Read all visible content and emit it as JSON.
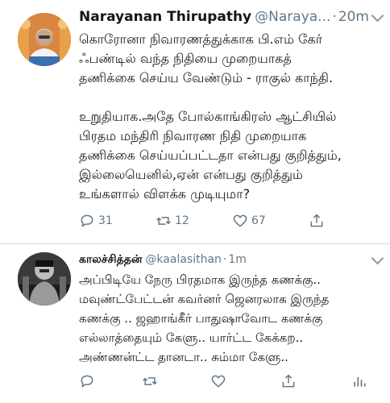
{
  "tweet1": {
    "name": "Narayanan Thirupathy",
    "handle": "@Naraya...",
    "separator": "·",
    "time": "20m",
    "text": "கொரோனா நிவாரணத்துக்காக பி.எம் கேர்\nஃபண்டில் வந்த நிதியை முறையாகத்\nதணிக்கை செய்ய வேண்டும் - ராகுல் காந்தி.\n\nஉறுதியாக.அதே போல்காங்கிரஸ் ஆட்சியில்\nபிரதம மந்திரி நிவாரண நிதி முறையாக\nதணிக்கை செய்யப்பட்டதா என்பது குறித்தும்,\nஇல்லையெனில்,ஏன் என்பது குறித்தும்\nஉங்களால் விளக்க முடியுமா?",
    "reply_count": "31",
    "retweet_count": "12",
    "like_count": "67"
  },
  "tweet2": {
    "name": "காலச்சித்தன்",
    "handle": "@kaalasithan",
    "separator": "·",
    "time": "1m",
    "text": "அப்பிடியே நேரு பிரதமாக இருந்த கணக்கு..\nமவுண்ட்பேட்டன் கவர்னர் ஜெனரலாக இருந்த\nகணக்கு .. ஜஹாங்கீர் பாதுஷாவோட கணக்கு\nஎல்லாத்தையும் கேளு.. யார்ட்ட கேக்கற..\nஅண்ணன்ட்ட தானடா.. சும்மா கேளு.."
  },
  "icons": {
    "reply": "reply-icon",
    "retweet": "retweet-icon",
    "like": "heart-icon",
    "share": "share-icon",
    "analytics": "analytics-icon",
    "menu": "chevron-down-icon"
  },
  "colors": {
    "text": "#14171a",
    "secondary": "#657786",
    "divider": "#d8dde1"
  }
}
